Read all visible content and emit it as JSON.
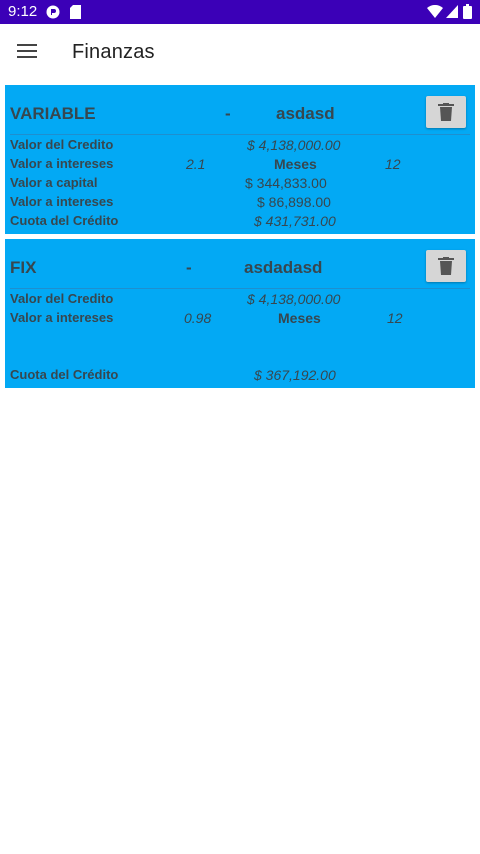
{
  "status_bar": {
    "time": "9:12"
  },
  "app_bar": {
    "title": "Finanzas"
  },
  "credits": [
    {
      "type": "VARIABLE",
      "separator": "-",
      "name": "asdasd",
      "valor_credito_label": "Valor del Credito",
      "valor_credito": "$ 4,138,000.00",
      "valor_intereses_label": "Valor a intereses",
      "tasa": "2.1",
      "meses_label": "Meses",
      "meses": "12",
      "valor_capital_label": "Valor a capital",
      "valor_capital": "$ 344,833.00",
      "valor_intereses2_label": "Valor a intereses",
      "valor_intereses2": "$ 86,898.00",
      "cuota_label": "Cuota del Crédito",
      "cuota": "$ 431,731.00"
    },
    {
      "type": "FIX",
      "separator": "-",
      "name": "asdadasd",
      "valor_credito_label": "Valor del Credito",
      "valor_credito": "$ 4,138,000.00",
      "valor_intereses_label": "Valor a intereses",
      "tasa": "0.98",
      "meses_label": "Meses",
      "meses": "12",
      "cuota_label": "Cuota del Crédito",
      "cuota": "$ 367,192.00"
    }
  ]
}
